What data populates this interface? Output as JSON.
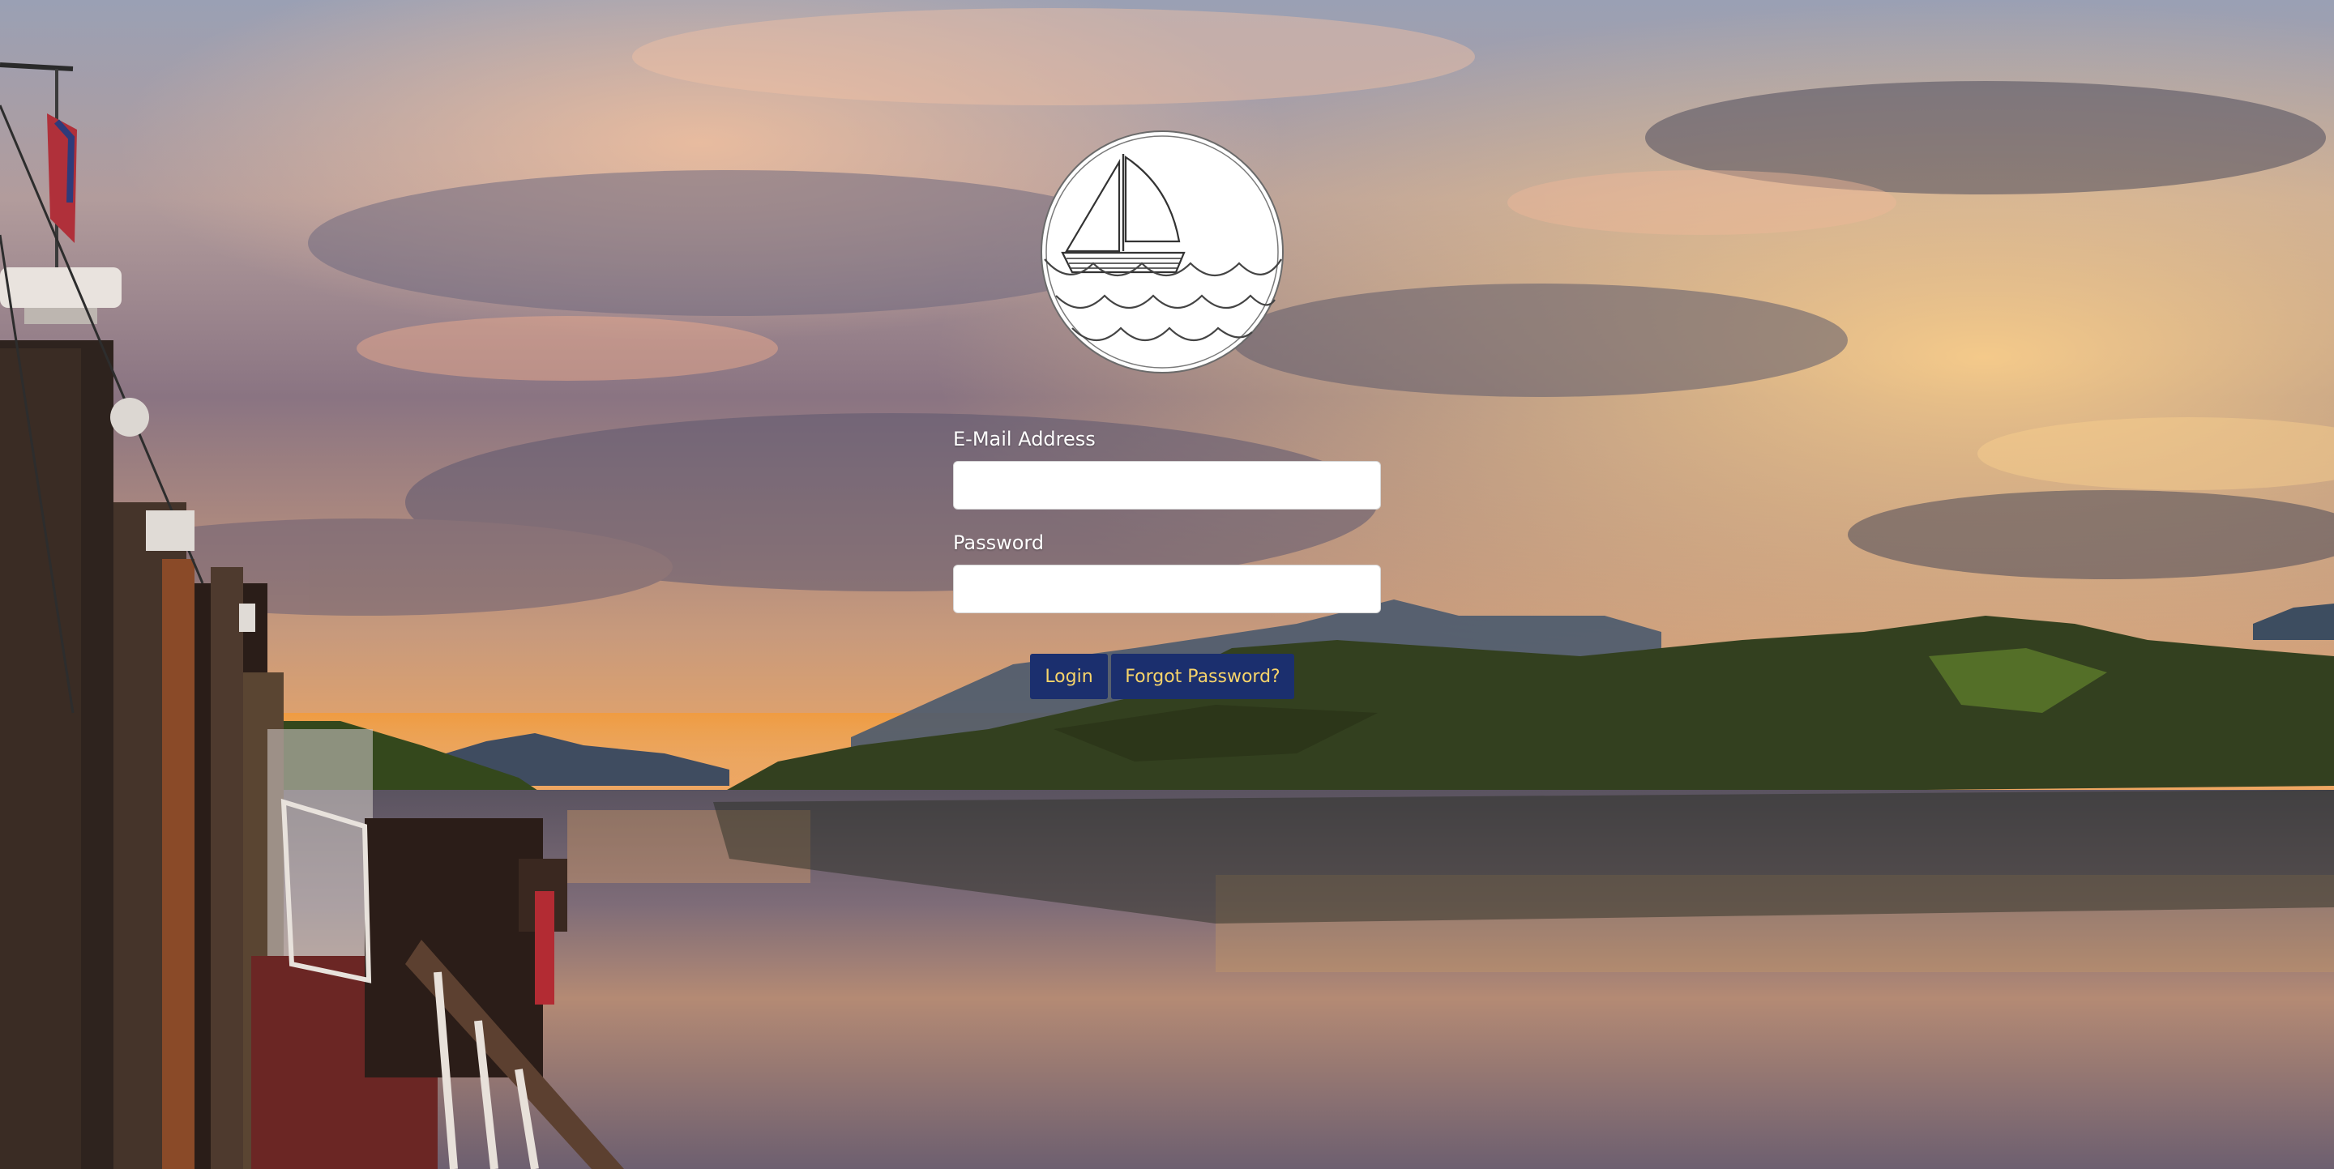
{
  "background": {
    "description_icon": "lake-sunset-background",
    "colors": {
      "sky_top": "#8e93a7",
      "sky_glow": "#f2b184",
      "water": "#6f6272",
      "hills": "#2f3a22",
      "accent_blue": "#1b2f6e",
      "accent_gold": "#f7d46a"
    }
  },
  "logo": {
    "icon": "sailboat-waves-logo"
  },
  "form": {
    "email_label": "E-Mail Address",
    "email_value": "",
    "email_placeholder": "",
    "password_label": "Password",
    "password_value": "",
    "password_placeholder": ""
  },
  "actions": {
    "login_label": "Login",
    "forgot_label": "Forgot Password?"
  }
}
